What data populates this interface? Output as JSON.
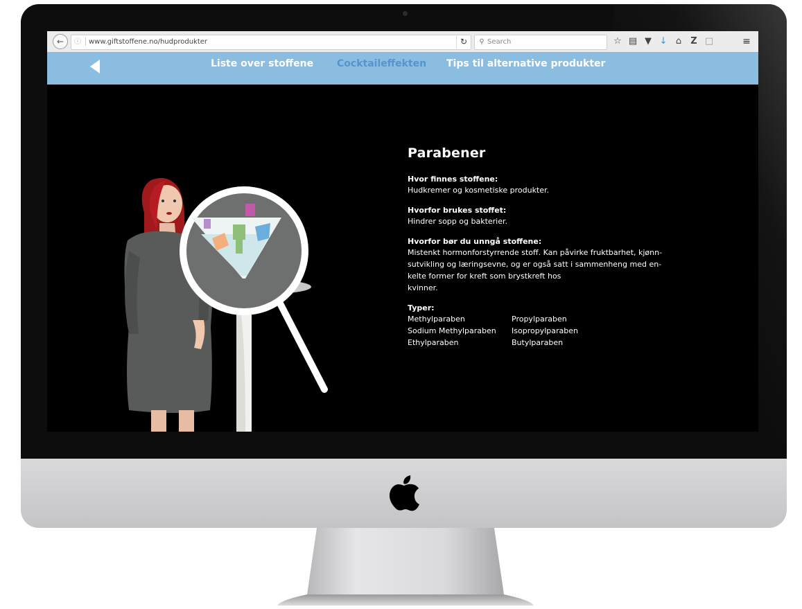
{
  "browser": {
    "url": "www.giftstoffene.no/hudprodukter",
    "search_placeholder": "Search"
  },
  "nav": {
    "items": [
      {
        "label": "Liste over stoffene",
        "active": false
      },
      {
        "label": "Cocktaileffekten",
        "active": true
      },
      {
        "label": "Tips til alternative produkter",
        "active": false
      }
    ],
    "active_color": "#5594cc",
    "bar_color": "#8bbde1"
  },
  "info": {
    "title": "Parabener",
    "where_label": "Hvor finnes stoffene:",
    "where_text": "Hudkremer og kosmetiske produkter.",
    "why_used_label": "Hvorfor brukes stoffet:",
    "why_used_text": "Hindrer sopp og bakterier.",
    "why_avoid_label": "Hvorfor bør du unngå stoffene:",
    "why_avoid_lines": [
      "Mistenkt hormonforstyrrende stoff. Kan påvirke fruktbarhet, kjønn-",
      "sutvikling og læringsevne, og er også satt i sammenheng med en-",
      "kelte former for kreft som brystkreft hos",
      "kvinner."
    ],
    "types_label": "Typer:",
    "types_col1": [
      "Methylparaben",
      "Sodium Methylparaben",
      "Ethylparaben"
    ],
    "types_col2": [
      "Propylparaben",
      "Isopropylparaben",
      "Butylparaben"
    ]
  }
}
